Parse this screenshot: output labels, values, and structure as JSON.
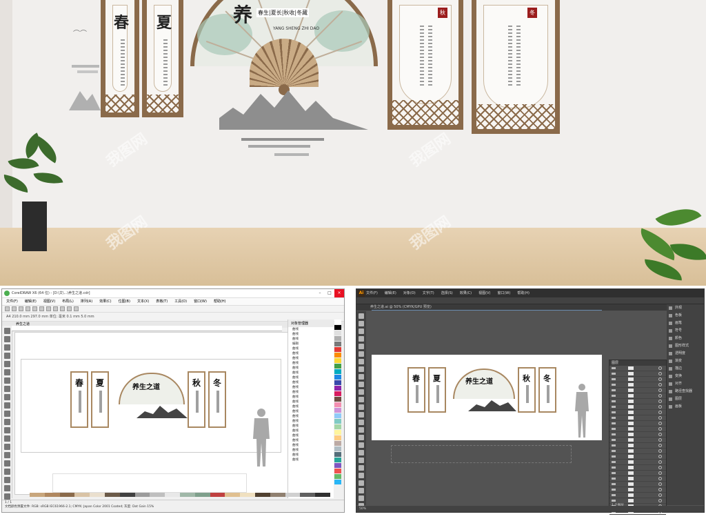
{
  "hero": {
    "spring_char": "春",
    "summer_char": "夏",
    "fan_title_char": "养",
    "fan_tagline": "春生|夏长|秋收|冬藏",
    "fan_pinyin": "YANG SHENG ZHI DAO",
    "seal_left": "秋",
    "seal_right": "冬",
    "watermark": "我图网"
  },
  "left_app": {
    "title": "CorelDRAW X6 (64 位) - [D:\\文\\...\\养生之道.cdr]",
    "menu": [
      "文件(F)",
      "编辑(E)",
      "视图(V)",
      "布局(L)",
      "排列(A)",
      "效果(C)",
      "位图(B)",
      "文本(X)",
      "表格(T)",
      "工具(O)",
      "窗口(W)",
      "帮助(H)"
    ],
    "prop_text": "A4  210.0 mm  297.0 mm  单位: 毫米  0.1 mm  5.0 mm",
    "tab_label": "养生之道",
    "docker_title": "对象管理器",
    "docker_rows": [
      "曲线",
      "曲线",
      "曲线",
      "编辑",
      "曲线",
      "曲线",
      "曲线",
      "曲线",
      "曲线",
      "曲线",
      "曲线",
      "曲线",
      "曲线",
      "曲线",
      "曲线",
      "曲线",
      "曲线",
      "曲线",
      "曲线",
      "曲线",
      "曲线",
      "曲线",
      "曲线",
      "曲线",
      "曲线",
      "曲线",
      "曲线",
      "曲线"
    ],
    "canvas_chars": [
      "春",
      "夏",
      "养生之道",
      "秋",
      "冬"
    ],
    "status_text": "文档颜色预置文件: RGB: sRGB IEC61966-2.1; CMYK: Japan Color 2001 Coated; 灰度: Dot Gain 15%",
    "page_nav": "1 / 1"
  },
  "right_app": {
    "logo": "Ai",
    "menu": [
      "文件(F)",
      "编辑(E)",
      "对象(O)",
      "文字(T)",
      "选择(S)",
      "效果(C)",
      "视图(V)",
      "窗口(W)",
      "帮助(H)"
    ],
    "tab_label": "养生之道.ai @ 50% (CMYK/GPU 预览)",
    "panels": [
      "外观",
      "色板",
      "画笔",
      "符号",
      "颜色",
      "图形样式",
      "透明度",
      "渐变",
      "描边",
      "变换",
      "对齐",
      "路径查找器",
      "图层",
      "画板"
    ],
    "layers_title": "图层",
    "layer_count_label": "1 个图层",
    "canvas_chars": [
      "春",
      "夏",
      "养生之道",
      "秋",
      "冬"
    ],
    "status_text": "50%"
  }
}
